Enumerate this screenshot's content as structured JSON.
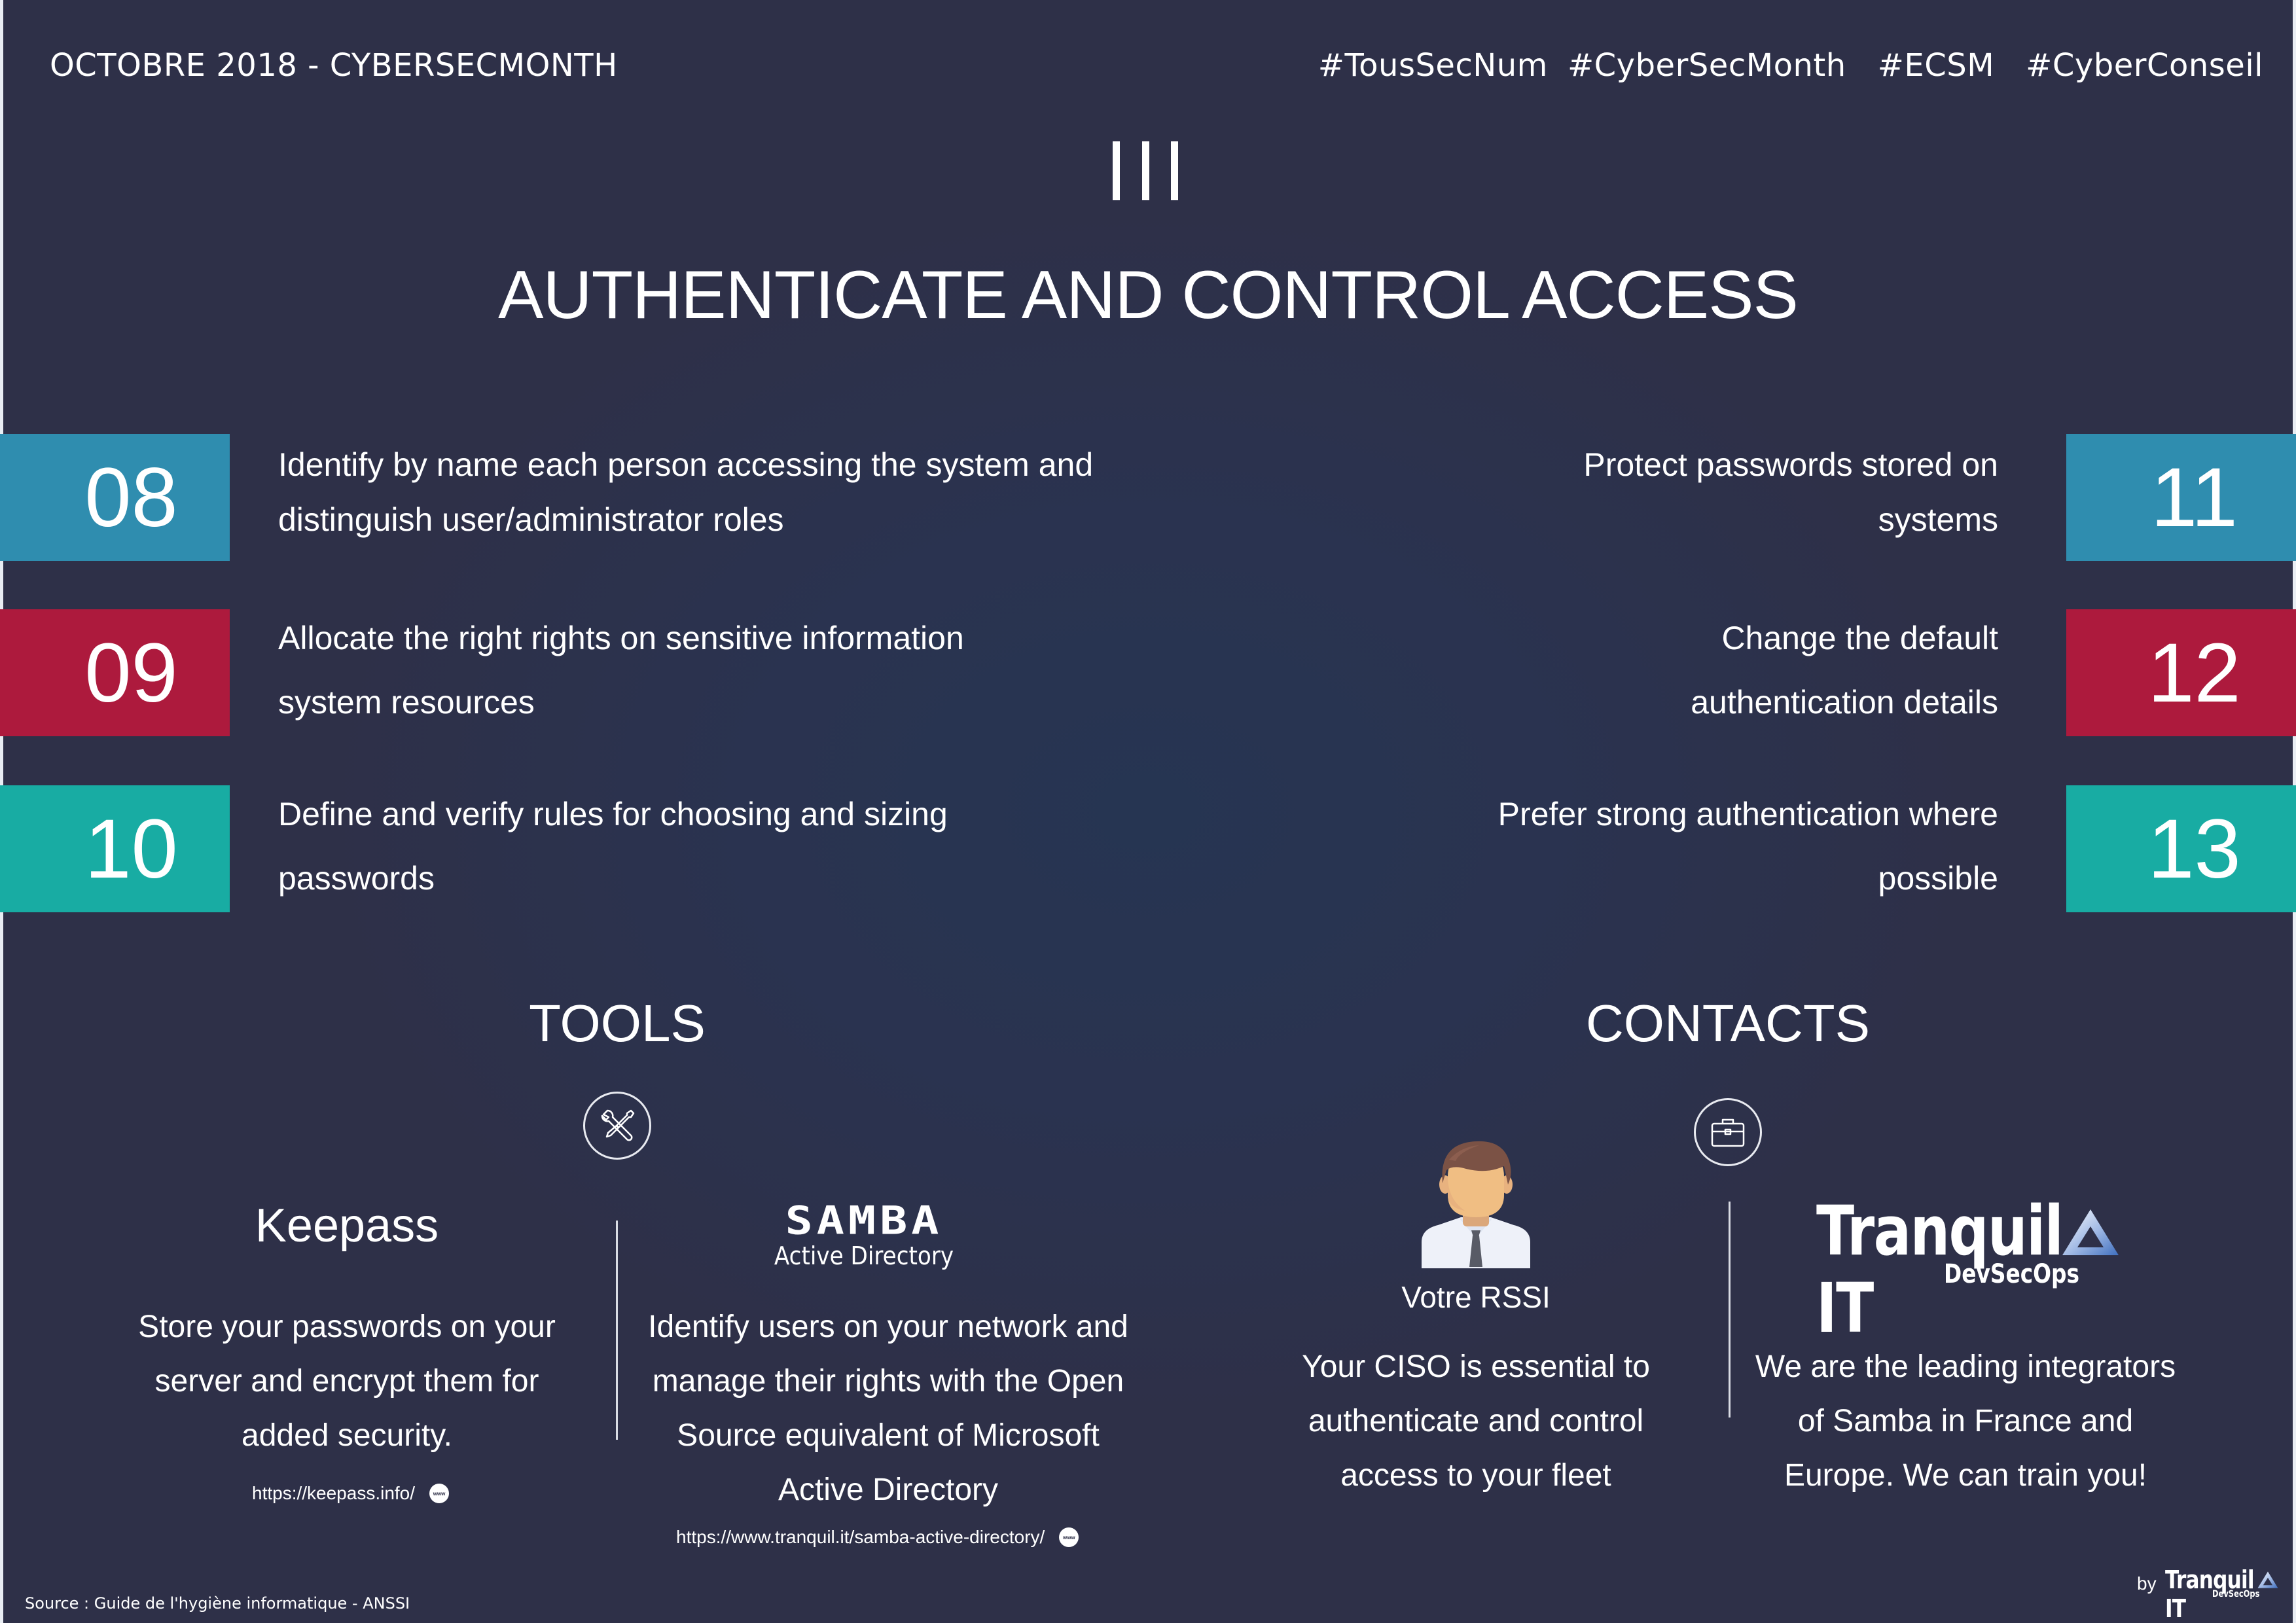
{
  "header": {
    "left": "OCTOBRE 2018 - CYBERSECMONTH",
    "hashtags": [
      "#TousSecNum",
      "#CyberSecMonth",
      "#ECSM",
      "#CyberConseil"
    ]
  },
  "section": {
    "numeral": "III",
    "title": "AUTHENTICATE AND CONTROL ACCESS"
  },
  "rules": {
    "left": [
      {
        "number": "08",
        "color": "#2f8daf",
        "lines": [
          "Identify by name each person accessing the system and",
          "distinguish user/administrator roles"
        ]
      },
      {
        "number": "09",
        "color": "#ad1a3d",
        "lines": [
          "Allocate the right rights on sensitive information",
          "system resources"
        ]
      },
      {
        "number": "10",
        "color": "#18aca3",
        "lines": [
          "Define and verify rules for choosing and sizing",
          "passwords"
        ]
      }
    ],
    "right": [
      {
        "number": "11",
        "color": "#2f8daf",
        "lines": [
          "Protect passwords stored on",
          "systems"
        ]
      },
      {
        "number": "12",
        "color": "#ad1a3d",
        "lines": [
          "Change the default",
          "authentication details"
        ]
      },
      {
        "number": "13",
        "color": "#18aca3",
        "lines": [
          "Prefer strong authentication where",
          "possible"
        ]
      }
    ]
  },
  "tools": {
    "heading": "TOOLS",
    "icon": "tools-icon",
    "keepass": {
      "name": "Keepass",
      "desc": [
        "Store your passwords on your",
        "server and encrypt them for",
        "added security."
      ],
      "link": "https://keepass.info/",
      "link_badge": "www"
    },
    "samba": {
      "logo_word": "SAMBA",
      "logo_sub": "Active Directory",
      "desc": [
        "Identify users on your network and",
        "manage their rights with the Open",
        "Source equivalent of Microsoft",
        "Active Directory"
      ],
      "link": "https://www.tranquil.it/samba-active-directory/",
      "link_badge": "www"
    }
  },
  "contacts": {
    "heading": "CONTACTS",
    "icon": "briefcase-icon",
    "rssi": {
      "label": "Votre RSSI",
      "desc": [
        "Your CISO is essential to",
        "authenticate and control",
        "access to your fleet"
      ]
    },
    "tranquil": {
      "logo_name": "Tranquil IT",
      "logo_sub": "DevSecOps",
      "desc": [
        "We are the leading integrators",
        "of Samba in France and",
        "Europe. We can train you!"
      ]
    }
  },
  "footer": {
    "source": "Source : Guide de l'hygiène informatique - ANSSI",
    "by": "by",
    "brand": "Tranquil IT",
    "brand_sub": "DevSecOps"
  },
  "colors": {
    "background": "#2e3048",
    "blue": "#2f8daf",
    "red": "#ad1a3d",
    "teal": "#18aca3",
    "logo_accent": "#4a78c0"
  }
}
